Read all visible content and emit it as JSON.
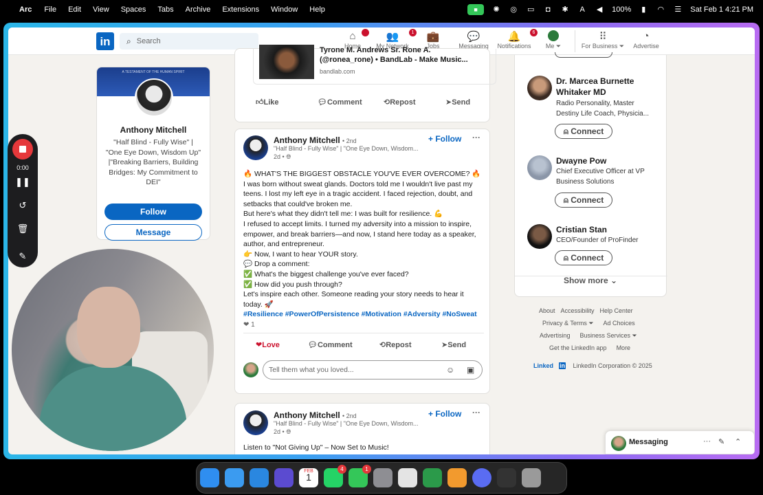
{
  "menubar": {
    "app": "Arc",
    "items": [
      "File",
      "Edit",
      "View",
      "Spaces",
      "Tabs",
      "Archive",
      "Extensions",
      "Window",
      "Help"
    ],
    "battery": "100%",
    "datetime": "Sat Feb 1  4:21 PM"
  },
  "linkedin": {
    "logo": "in",
    "search_placeholder": "Search",
    "nav": [
      {
        "label": "Home",
        "icon": "home-icon",
        "badge": ""
      },
      {
        "label": "My Network",
        "icon": "network-icon",
        "badge": "1"
      },
      {
        "label": "Jobs",
        "icon": "jobs-icon",
        "badge": ""
      },
      {
        "label": "Messaging",
        "icon": "messaging-icon",
        "badge": ""
      },
      {
        "label": "Notifications",
        "icon": "bell-icon",
        "badge": "6"
      },
      {
        "label": "Me ⏷",
        "icon": "avatar",
        "badge": ""
      },
      {
        "label": "For Business ⏷",
        "icon": "grid-icon",
        "badge": ""
      },
      {
        "label": "Advertise",
        "icon": "compass-icon",
        "badge": ""
      }
    ]
  },
  "profile": {
    "name": "Anthony Mitchell",
    "headline": "\"Half Blind - Fully Wise\" | \"One Eye Down, Wisdom Up\" |\"Breaking Barriers, Building Bridges: My Commitment to DEI\"",
    "banner_text": "A TESTAMENT OF THE HUMAN SPIRIT",
    "follow": "Follow",
    "message": "Message"
  },
  "shared_post": {
    "title1": "Tyrone M. Andrews Sr. Rone A.",
    "title2": "(@ronea_rone) • BandLab - Make Music...",
    "source": "bandlab.com",
    "actions": [
      "Like",
      "Comment",
      "Repost",
      "Send"
    ]
  },
  "post": {
    "author": "Anthony Mitchell",
    "degree": "• 2nd",
    "subtitle": "\"Half Blind - Fully Wise\" | \"One Eye Down, Wisdom...",
    "time": "2d •",
    "follow": "+ Follow",
    "lines": [
      "🔥 WHAT'S THE BIGGEST OBSTACLE YOU'VE EVER OVERCOME? 🔥",
      "I was born without sweat glands. Doctors told me I wouldn't live past my",
      "teens. I lost my left eye in a tragic accident. I faced rejection, doubt, and",
      "setbacks that could've broken me.",
      "But here's what they didn't tell me: I was built for resilience. 💪",
      "I refused to accept limits. I turned my adversity into a mission to inspire,",
      "empower, and break barriers—and now, I stand here today as a speaker,",
      "author, and entrepreneur.",
      "👉 Now, I want to hear YOUR story.",
      "💬 Drop a comment:",
      "✅ What's the biggest challenge you've ever faced?",
      "✅ How did you push through?",
      "Let's inspire each other. Someone reading your story needs to hear it",
      "today. 🚀"
    ],
    "hashtags": "#Resilience #PowerOfPersistence #Motivation #Adversity #NoSweat",
    "reactions": "❤ 1",
    "actions": [
      "Love",
      "Comment",
      "Repost",
      "Send"
    ],
    "comment_placeholder": "Tell them what you loved..."
  },
  "post2": {
    "author": "Anthony Mitchell",
    "degree": "• 2nd",
    "subtitle": "\"Half Blind - Fully Wise\" | \"One Eye Down, Wisdom...",
    "time": "2d •",
    "follow": "+ Follow",
    "text": "Listen to \"Not Giving Up\" – Now Set to Music!"
  },
  "suggestions": [
    {
      "name": "Dr. Marcea Burnette Whitaker MD",
      "desc1": "Radio Personality, Master",
      "desc2": "Destiny Life Coach, Physicia...",
      "button": "Connect"
    },
    {
      "name": "Dwayne Pow",
      "desc1": "Chief Executive Officer at VP",
      "desc2": "Business Solutions",
      "button": "Connect"
    },
    {
      "name": "Cristian Stan",
      "desc1": "CEO/Founder of ProFinder",
      "desc2": "",
      "button": "Connect"
    }
  ],
  "show_more": "Show more ⌄",
  "footer": {
    "row1": [
      "About",
      "Accessibility",
      "Help Center"
    ],
    "row2": [
      "Privacy & Terms ⏷",
      "Ad Choices"
    ],
    "row3": [
      "Advertising",
      "Business Services ⏷"
    ],
    "row4": [
      "Get the LinkedIn app",
      "More"
    ],
    "brand": "Linked",
    "brand_in": "in",
    "copyright": "LinkedIn Corporation © 2025"
  },
  "messaging": {
    "label": "Messaging"
  },
  "recorder": {
    "time": "0:00"
  },
  "dock": {
    "apps": [
      {
        "name": "finder",
        "color": "#2f8ef0",
        "badge": ""
      },
      {
        "name": "mail",
        "color": "#3b9bf0",
        "badge": ""
      },
      {
        "name": "safari",
        "color": "#2a87e0",
        "badge": ""
      },
      {
        "name": "craft",
        "color": "#5b4bd0",
        "badge": ""
      },
      {
        "name": "calendar",
        "color": "#ffffff",
        "badge": ""
      },
      {
        "name": "whatsapp",
        "color": "#25d366",
        "badge": "4"
      },
      {
        "name": "messages",
        "color": "#34c759",
        "badge": "1"
      },
      {
        "name": "system-settings",
        "color": "#8e8e93",
        "badge": ""
      },
      {
        "name": "launchpad",
        "color": "#e4e4e4",
        "badge": ""
      },
      {
        "name": "screen-recorder",
        "color": "#2b9a4a",
        "badge": ""
      },
      {
        "name": "pages",
        "color": "#f29a2e",
        "badge": ""
      },
      {
        "name": "arc",
        "color": "#5a6cf2",
        "badge": ""
      },
      {
        "name": "photo-viewer",
        "color": "#333333",
        "badge": ""
      },
      {
        "name": "trash",
        "color": "#9a9a9a",
        "badge": ""
      }
    ]
  },
  "calendar_date": {
    "month": "FEB",
    "day": "1"
  }
}
